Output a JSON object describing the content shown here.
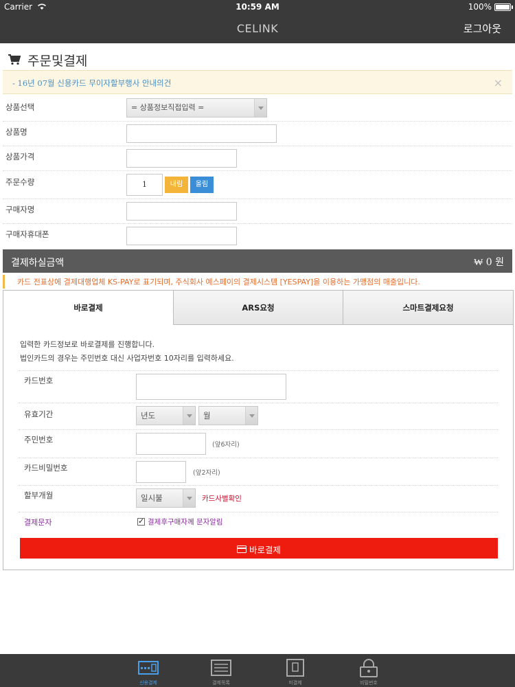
{
  "status_bar": {
    "carrier": "Carrier",
    "time": "10:59 AM",
    "battery": "100%"
  },
  "nav": {
    "title": "CELINK",
    "logout_label": "로그아웃"
  },
  "page": {
    "title": "주문및결제"
  },
  "notice": {
    "text": "- 16년 07월 신용카드 무이자할부행사 안내의건",
    "close": "×"
  },
  "order_form": {
    "product_select": {
      "label": "상품선택",
      "value": "= 상품정보직접입력 ="
    },
    "product_name": {
      "label": "상품명",
      "value": ""
    },
    "product_price": {
      "label": "상품가격",
      "value": ""
    },
    "quantity": {
      "label": "주문수량",
      "value": "1",
      "down_label": "내림",
      "up_label": "올림"
    },
    "buyer_name": {
      "label": "구매자명",
      "value": ""
    },
    "buyer_phone": {
      "label": "구매자휴대폰",
      "value": ""
    }
  },
  "total": {
    "label": "결제하실금액",
    "amount": "₩ 0 원"
  },
  "warning": {
    "text": "카드 전표상에 결제대행업체 KS-PAY로 표기되며, 주식회사 예스페이의 결제시스템 [YESPAY]을 이용하는 가맹점의 매출입니다."
  },
  "payment_tabs": [
    {
      "label": "바로결제",
      "active": true
    },
    {
      "label": "ARS요청",
      "active": false
    },
    {
      "label": "스마트결제요청",
      "active": false
    }
  ],
  "payment": {
    "intro_line1": "입력한 카드정보로 바로결제를 진행합니다.",
    "intro_line2": "법인카드의 경우는 주민번호 대신 사업자번호 10자리를 입력하세요.",
    "card_number": {
      "label": "카드번호",
      "value": ""
    },
    "expiry": {
      "label": "유효기간",
      "year_value": "년도",
      "month_value": "월"
    },
    "resident_no": {
      "label": "주민번호",
      "hint": "(앞6자리)"
    },
    "card_password": {
      "label": "카드비밀번호",
      "hint": "(앞2자리)"
    },
    "installment": {
      "label": "할부개월",
      "value": "일시불",
      "card_check_link": "카드사별확인"
    },
    "sms": {
      "label": "결제문자",
      "checkbox_label": "결제후구매자께 문자알림",
      "checked": true
    },
    "submit_label": "바로결제"
  },
  "tab_bar": [
    {
      "label": "신용결제",
      "icon": "card-reader-icon",
      "active": true
    },
    {
      "label": "결제목록",
      "icon": "list-icon",
      "active": false
    },
    {
      "label": "미결제",
      "icon": "document-icon",
      "active": false
    },
    {
      "label": "비밀번호",
      "icon": "lock-icon",
      "active": false
    }
  ],
  "colors": {
    "header_bg": "#3a3a3a",
    "submit_red": "#ee1b0f",
    "down_orange": "#f4b43a",
    "up_blue": "#3a8ed8",
    "notice_bg": "#fcf6e3",
    "active_tab_blue": "#4a9ee8"
  }
}
